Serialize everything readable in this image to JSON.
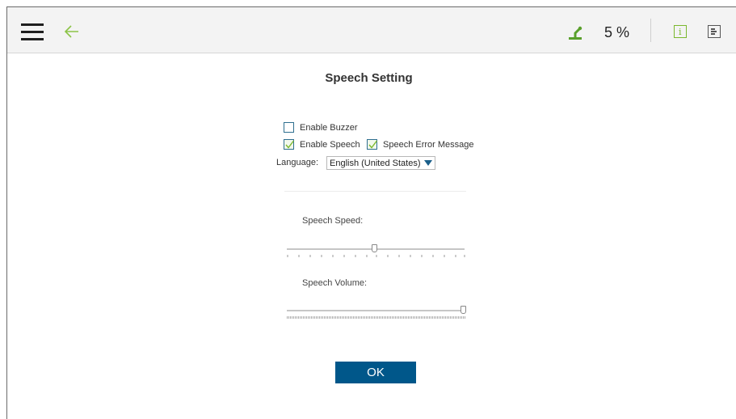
{
  "topbar": {
    "menu_icon": "hamburger-menu-icon",
    "back_icon": "back-arrow-icon",
    "robot_icon": "robot-arm-icon",
    "battery_percent": "5 %",
    "info_icon": "info-icon",
    "log_icon": "log-panel-icon",
    "accent_color": "#7bb82e"
  },
  "dialog": {
    "title": "Speech Setting",
    "enable_buzzer": {
      "label": "Enable Buzzer",
      "checked": false
    },
    "enable_speech": {
      "label": "Enable Speech",
      "checked": true
    },
    "speech_error_message": {
      "label": "Speech Error Message",
      "checked": true
    },
    "language": {
      "label": "Language:",
      "selected": "English (United States)"
    },
    "speech_speed": {
      "label": "Speech Speed:",
      "value_fraction": 0.5
    },
    "speech_volume": {
      "label": "Speech Volume:",
      "value_fraction": 1.0
    },
    "ok_label": "OK",
    "button_color": "#00578a"
  }
}
